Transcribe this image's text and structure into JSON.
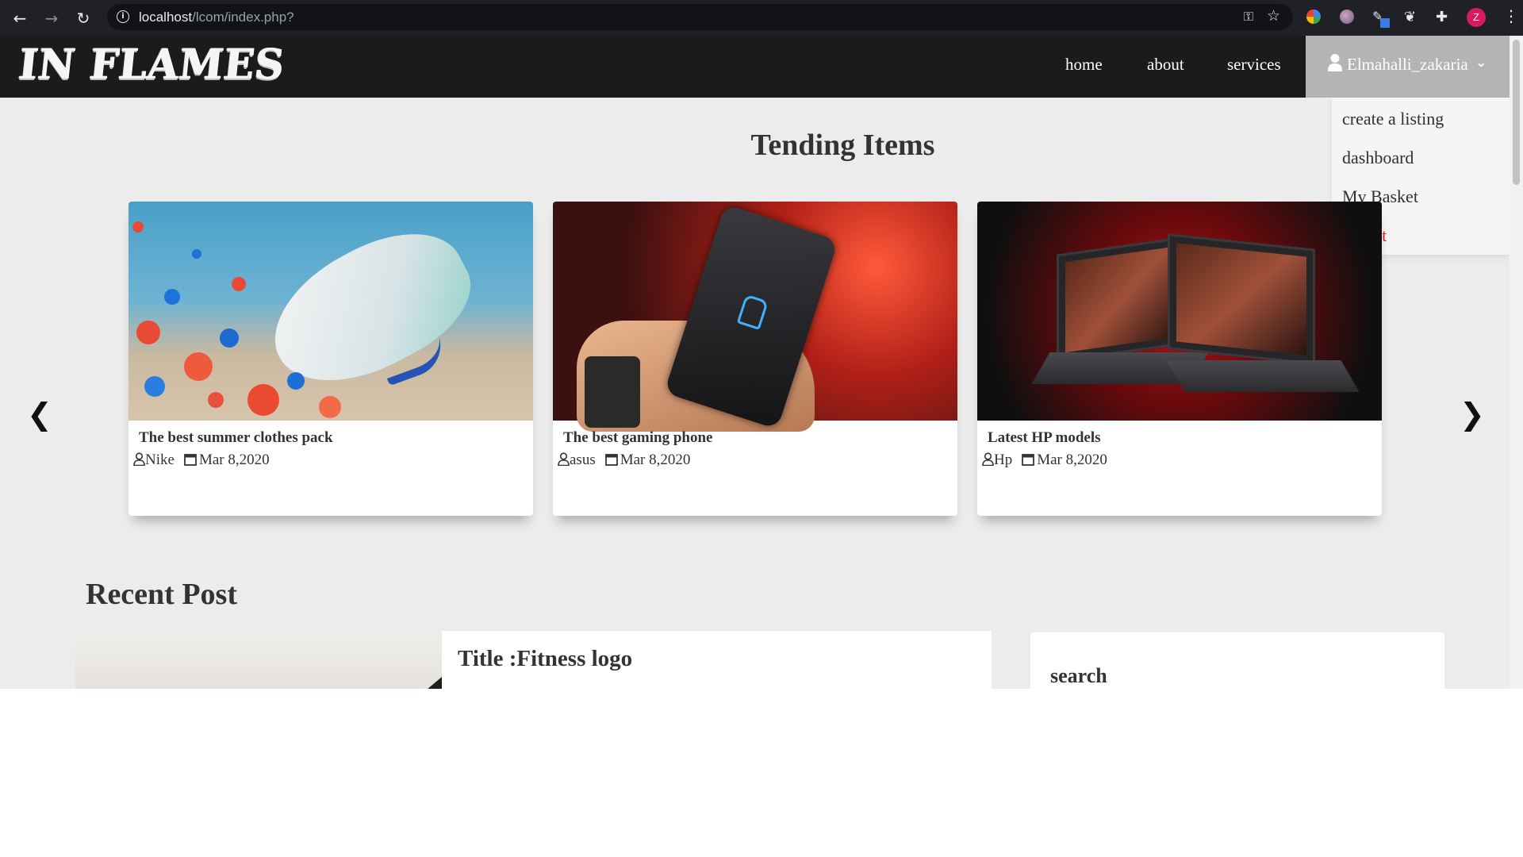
{
  "browser": {
    "url_host": "localhost",
    "url_path": "/lcom/index.php?",
    "profile_initial": "Z",
    "icons": [
      "back-icon",
      "forward-icon",
      "reload-icon",
      "info-icon",
      "key-icon",
      "star-icon",
      "extensions-icon",
      "menu-icon"
    ]
  },
  "site": {
    "logo_text": "IN FLAMES",
    "nav": {
      "home": "home",
      "about": "about",
      "services": "services",
      "user": "Elmahalli_zakaria"
    },
    "dropdown": {
      "items": [
        "create a listing",
        "dashboard",
        "My Basket",
        "logout"
      ],
      "logout_color": "#e0202a"
    },
    "trending": {
      "title": "Tending Items",
      "cards": [
        {
          "title": "The best summer clothes pack",
          "author": "Nike",
          "date": "Mar 8,2020"
        },
        {
          "title": "The best gaming phone",
          "author": "asus",
          "date": "Mar 8,2020"
        },
        {
          "title": "Latest HP models",
          "author": "Hp",
          "date": "Mar 8,2020"
        }
      ]
    },
    "recent": {
      "title": "Recent Post",
      "post_title": "Title :Fitness logo"
    },
    "sidebar": {
      "search_title": "search"
    },
    "colors": {
      "navbar": "#1b1b1b",
      "user_button": "#b4b4b4",
      "page_bg": "#ececec"
    }
  }
}
